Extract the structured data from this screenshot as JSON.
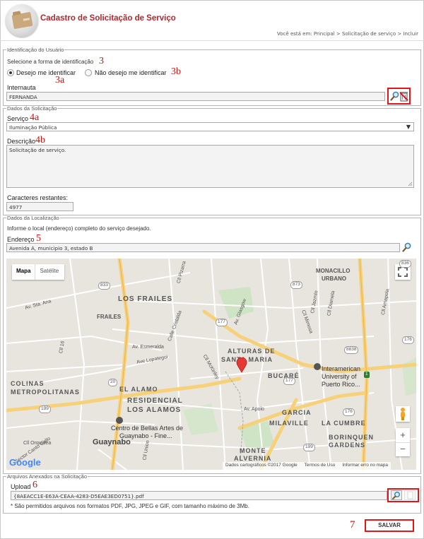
{
  "header": {
    "title": "Cadastro de Solicitação de Serviço",
    "breadcrumb": "Você está em: Principal > Solicitação de serviço > Incluir"
  },
  "identificacao": {
    "legend": "Identificação do Usuário",
    "instruction": "Selecione a forma de identificação",
    "options": [
      "Desejo me identificar",
      "Não desejo me identificar"
    ],
    "selected": "Desejo me identificar",
    "internauta_label": "Internauta",
    "internauta_value": "FERNANDA"
  },
  "solicitacao": {
    "legend": "Dados da Solicitação",
    "servico_label": "Serviço",
    "servico_value": "Iluminação Pública",
    "descricao_label": "Descrição",
    "descricao_value": "Solicitação de serviço.",
    "caracteres_label": "Caracteres restantes:",
    "caracteres_value": "4977"
  },
  "localizacao": {
    "legend": "Dados da Localização",
    "instruction": "Informe o local (endereço) completo do serviço desejado.",
    "endereco_label": "Endereço",
    "endereco_value": "Avenida A, municipio 3, estado B"
  },
  "map": {
    "type_buttons": [
      "Mapa",
      "Satélite"
    ],
    "selected_type": "Mapa",
    "zoom_in": "+",
    "zoom_out": "−",
    "google": "Google",
    "footer": [
      "Dados cartográficos ©2017 Google",
      "Termos de Uso",
      "Informar erro no mapa"
    ],
    "places": {
      "los_frailes": "LOS FRAILES",
      "frailes": "FRAILES",
      "colinas": "COLINAS",
      "metropolitanas": "METROPOLITANAS",
      "el_alamo": "EL ALAMO",
      "residencial": "RESIDENCIAL",
      "los_alamos": "LOS ALAMOS",
      "guaynabo": "Guaynabo",
      "centro_bellas_1": "Centro de Bellas Artes de",
      "centro_bellas_2": "Guaynabo - Fine...",
      "alturas_1": "ALTURAS DE",
      "alturas_2": "SANTA MARIA",
      "bucare": "BUCARÉ",
      "garcia": "GARCIA",
      "milaville": "MILAVILLE",
      "la_cumbre": "LA CUMBRE",
      "borinquen": "BORINQUEN",
      "gardens": "GARDENS",
      "monte": "MONTE",
      "alvernia": "ALVERNIA",
      "monacillo_1": "MONACILLO",
      "monacillo_2": "URBANO",
      "inter_1": "Interamerican",
      "inter_2": "University of",
      "inter_3": "Puerto Rico..."
    },
    "streets": {
      "av_sta_ana": "Av. Sta. Ana",
      "av_esmeralda": "Av. Esmeralda",
      "av_lopategui": "Ave Lopategui",
      "av_apolo": "Av. Apolo",
      "calle_cristalda": "Calle Cristalda",
      "cll_mckinley": "Cll McKinley",
      "av_glasgow": "Av. Glasgow",
      "cll_pizarra": "Cll Pizarra",
      "cll_union": "Cll Union",
      "cll_orquidea": "Cll Orquídea",
      "cll_mimosa": "Cll Mimosa",
      "cll_jazmin": "Cll Jazmín",
      "cll_amapola": "Cll Amapola",
      "cll_diamela": "Cll Diamela",
      "sector_canto_gallo": "Sector Canto Gallo",
      "cll_16": "Cll 16"
    },
    "road_shields": [
      "833",
      "177",
      "199",
      "20",
      "838",
      "199",
      "1",
      "8838",
      "873",
      "176",
      "199",
      "176",
      "836",
      "177"
    ]
  },
  "anexos": {
    "legend": "Arquivos Anexados na Solicitação",
    "upload_label": "Upload",
    "upload_value": "{8AEACC1E-E63A-CEAA-4283-D5EAE3ED0751}.pdf",
    "note": "* São permitidos arquivos nos formatos PDF, JPG, JPEG e GIF, com tamanho máximo de 3Mb."
  },
  "actions": {
    "save_label": "SALVAR"
  },
  "annotations": {
    "a3": "3",
    "a3a": "3a",
    "a3b": "3b",
    "a4a": "4a",
    "a4b": "4b",
    "a5": "5",
    "a6": "6",
    "a7": "7"
  },
  "colors": {
    "title": "#b3262c",
    "highlight": "#e0161b",
    "annotation": "#c41212",
    "marker": "#e53935",
    "major_road": "#f6d17a"
  }
}
